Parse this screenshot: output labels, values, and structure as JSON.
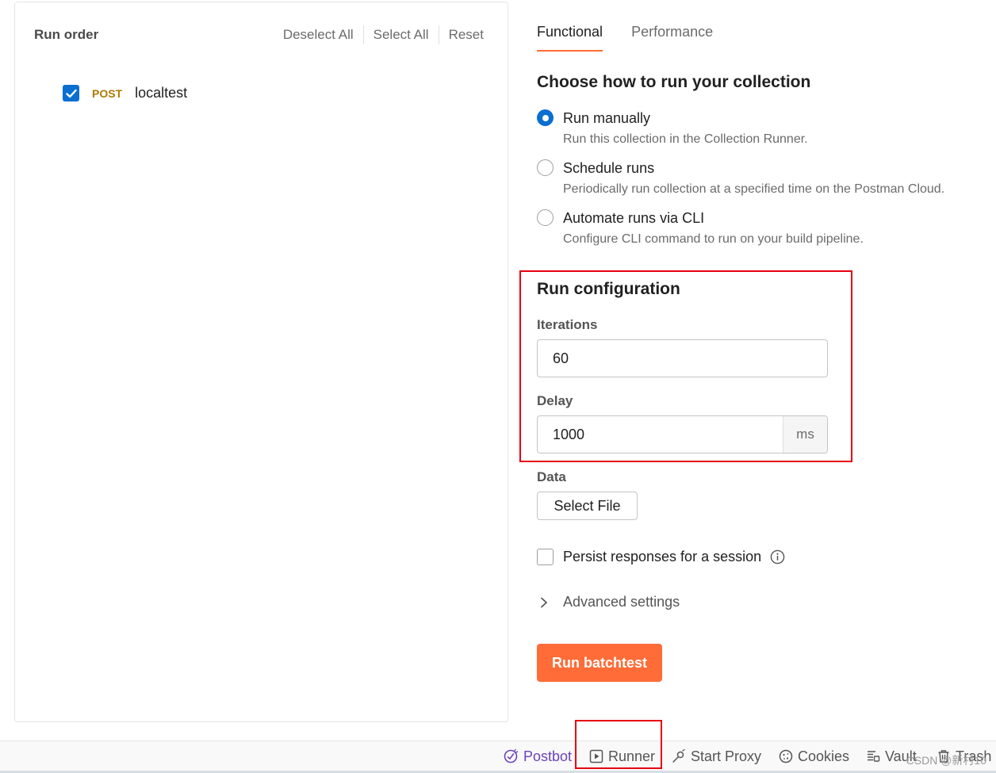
{
  "left_panel": {
    "title": "Run order",
    "actions": [
      "Deselect All",
      "Select All",
      "Reset"
    ],
    "requests": [
      {
        "method": "POST",
        "name": "localtest",
        "checked": true
      }
    ]
  },
  "tabs": [
    {
      "label": "Functional",
      "active": true
    },
    {
      "label": "Performance",
      "active": false
    }
  ],
  "run_mode": {
    "title": "Choose how to run your collection",
    "options": [
      {
        "label": "Run manually",
        "description": "Run this collection in the Collection Runner.",
        "selected": true
      },
      {
        "label": "Schedule runs",
        "description": "Periodically run collection at a specified time on the Postman Cloud.",
        "selected": false
      },
      {
        "label": "Automate runs via CLI",
        "description": "Configure CLI command to run on your build pipeline.",
        "selected": false
      }
    ]
  },
  "run_config": {
    "title": "Run configuration",
    "iterations_label": "Iterations",
    "iterations_value": "60",
    "delay_label": "Delay",
    "delay_value": "1000",
    "delay_unit": "ms",
    "data_label": "Data",
    "select_file_label": "Select File",
    "persist_label": "Persist responses for a session",
    "persist_checked": false,
    "advanced_label": "Advanced settings",
    "run_button_label": "Run batchtest"
  },
  "status_bar": {
    "items": [
      "Postbot",
      "Runner",
      "Start Proxy",
      "Cookies",
      "Vault",
      "Trash"
    ],
    "watermark": "CSDN @新村10"
  },
  "colors": {
    "accent": "#ff6c37",
    "primary_blue": "#0b6ed1",
    "method_post": "#ad7a03",
    "highlight": "#e60012",
    "postbot": "#6b44b8"
  }
}
